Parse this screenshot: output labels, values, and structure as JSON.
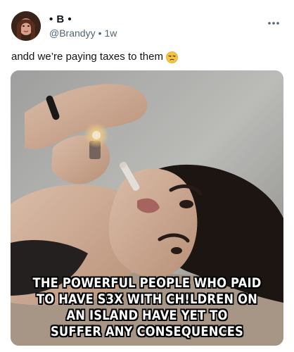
{
  "post": {
    "author": {
      "display_name": "• B •",
      "handle": "@Brandyy",
      "timestamp": "1w",
      "avatar_icon": "avatar-photo"
    },
    "text": "andd we’re paying taxes to them",
    "emoji": "unamused-face-emoji",
    "more_icon": "more-options-icon",
    "media": {
      "caption_lines": [
        "THE POWERFUL PEOPLE WHO PAID",
        "TO HAVE S3X WITH CH!LDREN ON",
        "AN ISLAND HAVE YET TO",
        "SUFFER ANY CONSEQUENCES"
      ]
    }
  },
  "colors": {
    "text_primary": "#0f1419",
    "text_secondary": "#536471",
    "caption_text": "#ffffff",
    "caption_outline": "#000000",
    "emoji_fill": "#f4c542"
  }
}
